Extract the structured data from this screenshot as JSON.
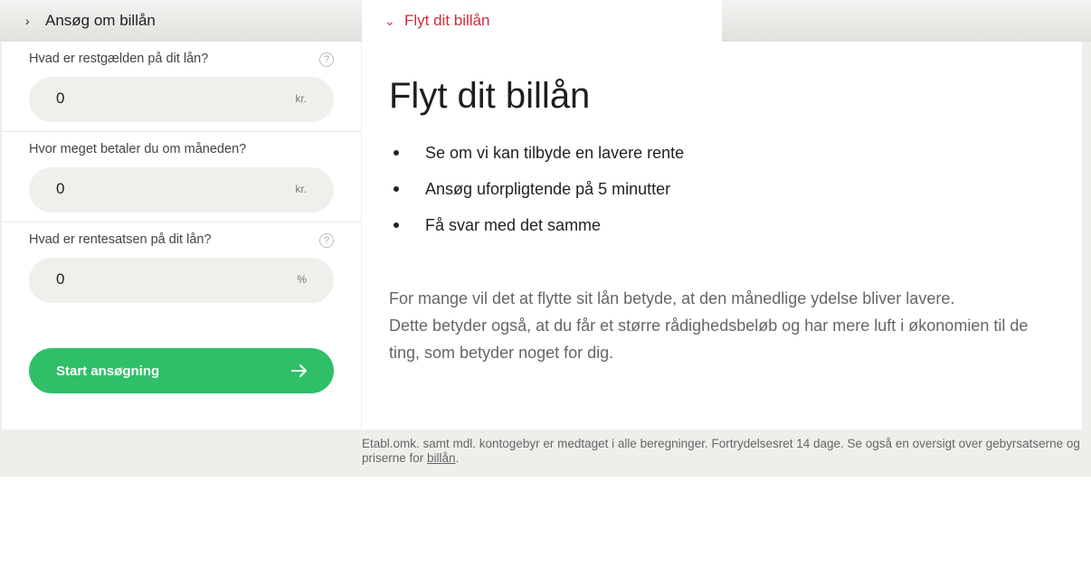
{
  "tabs": {
    "left": {
      "label": "Ansøg om billån",
      "icon": "chevron-right-icon"
    },
    "right": {
      "label": "Flyt dit billån",
      "icon": "chevron-down-icon"
    }
  },
  "form": {
    "fields": [
      {
        "question": "Hvad er restgælden på dit lån?",
        "value": "0",
        "unit": "kr.",
        "help": "?"
      },
      {
        "question": "Hvor meget betaler du om måneden?",
        "value": "0",
        "unit": "kr."
      },
      {
        "question": "Hvad er rentesatsen på dit lån?",
        "value": "0",
        "unit": "%",
        "help": "?"
      }
    ],
    "cta_label": "Start ansøgning"
  },
  "content": {
    "title": "Flyt dit billån",
    "bullets": [
      "Se om vi kan tilbyde en lavere rente",
      "Ansøg uforpligtende på 5 minutter",
      "Få svar med det samme"
    ],
    "paragraph": "For mange vil det at flytte sit lån betyde, at den månedlige ydelse bliver lavere.\nDette betyder også, at du får et større rådighedsbeløb og har mere luft i økonomien til de ting, som betyder noget for dig."
  },
  "footnote": {
    "text": "Etabl.omk. samt mdl. kontogebyr er medtaget i alle beregninger. Fortrydelsesret 14 dage. Se også en oversigt over gebyrsatserne og priserne for ",
    "link": "billån",
    "end": "."
  },
  "colors": {
    "accent": "#d42a3c",
    "cta": "#2fbf68",
    "input_bg": "#f1efec"
  }
}
